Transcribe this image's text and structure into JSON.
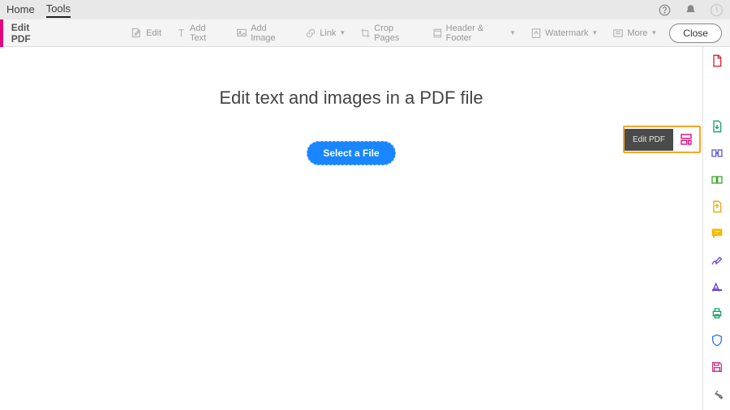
{
  "topbar": {
    "home": "Home",
    "tools": "Tools"
  },
  "toolbar": {
    "title": "Edit PDF",
    "edit": "Edit",
    "addText": "Add Text",
    "addImage": "Add Image",
    "link": "Link",
    "cropPages": "Crop Pages",
    "headerFooter": "Header & Footer",
    "watermark": "Watermark",
    "more": "More",
    "close": "Close"
  },
  "main": {
    "heading": "Edit text and images in a PDF file",
    "selectFile": "Select a File"
  },
  "tooltip": {
    "label": "Edit PDF"
  },
  "rightTools": [
    "create-pdf",
    "edit-pdf",
    "export-pdf",
    "organize-pages",
    "combine-files",
    "share",
    "comment",
    "fill-sign",
    "redact",
    "print",
    "protect",
    "save",
    "preferences"
  ]
}
